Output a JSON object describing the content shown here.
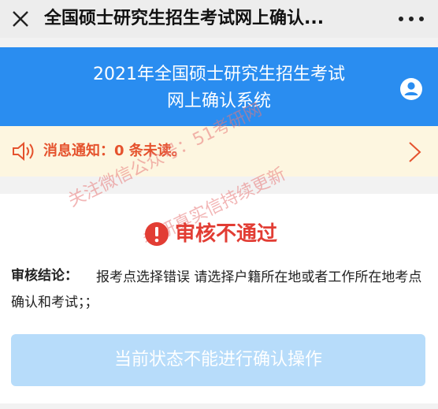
{
  "window": {
    "title": "全国硕士研究生招生考试网上确认..."
  },
  "banner": {
    "line1": "2021年全国硕士研究生招生考试",
    "line2": "网上确认系统"
  },
  "notice": {
    "text": "消息通知：0 条未读。"
  },
  "review": {
    "status": "审核不通过",
    "result_label": "审核结论：",
    "result_value": "报考点选择错误 请选择户籍所在地或者工作所在地考点确认和考试；；"
  },
  "action": {
    "button_label": "当前状态不能进行确认操作"
  },
  "watermark": {
    "line1": "关注微信公众号：51考研网",
    "line2": "考研真实信持续更新"
  },
  "colors": {
    "banner": "#2a8df0",
    "notice_bg": "#fdf6e0",
    "notice_text": "#e5522d",
    "status_red": "#e23d34",
    "disabled_button": "#b7dcfa"
  },
  "icons": [
    "close-icon",
    "more-icon",
    "user-icon",
    "speaker-icon",
    "chevron-right-icon",
    "error-icon"
  ]
}
